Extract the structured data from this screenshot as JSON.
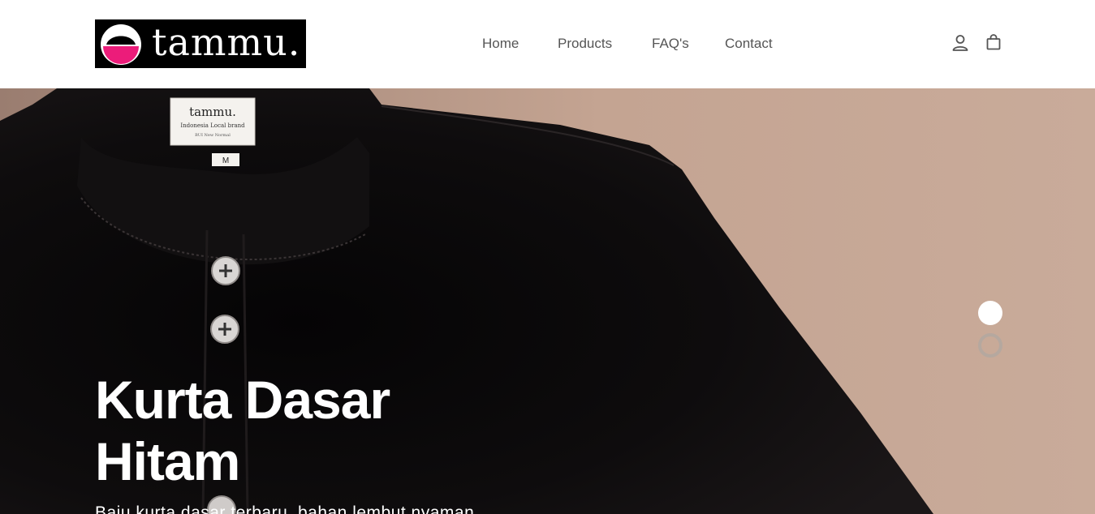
{
  "brand": {
    "name": "tammu."
  },
  "nav": {
    "items": [
      {
        "label": "Home"
      },
      {
        "label": "Products"
      },
      {
        "label": "FAQ's"
      },
      {
        "label": "Contact"
      }
    ]
  },
  "header_icons": [
    "user-icon",
    "shopping-bag-icon"
  ],
  "hero": {
    "title_line1": "Kurta Dasar",
    "title_line2": "Hitam",
    "subtitle": "Baju kurta dasar terbaru, bahan lembut nyaman",
    "product_label": {
      "brand": "tammu.",
      "line1": "Indonesia Local brand",
      "line2": "BUI New Normal",
      "size": "M"
    },
    "slides": {
      "count": 2,
      "active": 1
    }
  },
  "colors": {
    "header_bg": "#ffffff",
    "logo_bg": "#000000",
    "logo_accent": "#ec1c7a",
    "nav_text": "#555555",
    "hero_bg": "#c4a492",
    "shirt": "#0d0b0c",
    "hero_text": "#ffffff"
  }
}
